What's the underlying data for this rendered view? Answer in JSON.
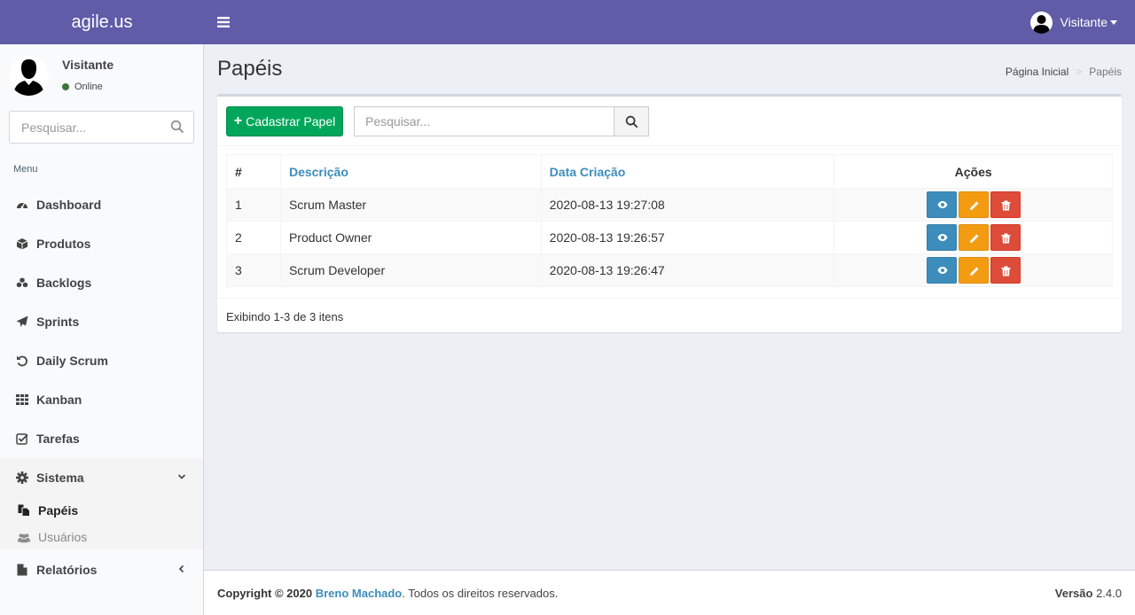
{
  "app": {
    "logo": "agile.us"
  },
  "header": {
    "user_name": "Visitante"
  },
  "sidebar": {
    "user_name": "Visitante",
    "status": "Online",
    "search_placeholder": "Pesquisar...",
    "menu_header": "Menu",
    "items": [
      {
        "label": "Dashboard",
        "icon": "dashboard-icon"
      },
      {
        "label": "Produtos",
        "icon": "cube-icon"
      },
      {
        "label": "Backlogs",
        "icon": "cubes-icon"
      },
      {
        "label": "Sprints",
        "icon": "paper-plane-icon"
      },
      {
        "label": "Daily Scrum",
        "icon": "undo-icon"
      },
      {
        "label": "Kanban",
        "icon": "grid-icon"
      },
      {
        "label": "Tarefas",
        "icon": "check-square-icon"
      },
      {
        "label": "Sistema",
        "icon": "gear-icon"
      },
      {
        "label": "Relatórios",
        "icon": "file-icon"
      }
    ],
    "sub_items": [
      {
        "label": "Papéis",
        "icon": "files-icon"
      },
      {
        "label": "Usuários",
        "icon": "users-icon"
      }
    ]
  },
  "page": {
    "title": "Papéis",
    "breadcrumb": {
      "home": "Página Inicial",
      "separator": ">",
      "current": "Papéis"
    }
  },
  "toolbar": {
    "add_label": "Cadastrar Papel",
    "search_placeholder": "Pesquisar..."
  },
  "table": {
    "columns": [
      "#",
      "Descrição",
      "Data Criação",
      "Ações"
    ],
    "rows": [
      {
        "id": "1",
        "descricao": "Scrum Master",
        "data": "2020-08-13 19:27:08"
      },
      {
        "id": "2",
        "descricao": "Product Owner",
        "data": "2020-08-13 19:26:57"
      },
      {
        "id": "3",
        "descricao": "Scrum Developer",
        "data": "2020-08-13 19:26:47"
      }
    ],
    "summary": "Exibindo 1-3 de 3 itens"
  },
  "footer": {
    "copyright": "Copyright © 2020",
    "author": "Breno Machado",
    "rights": ". Todos os direitos reservados.",
    "version_label": "Versão",
    "version": "2.4.0"
  },
  "colors": {
    "header": "#605ca8",
    "success": "#00a65a",
    "info": "#3c8dbc",
    "warning": "#f39c12",
    "danger": "#dd4b39"
  }
}
